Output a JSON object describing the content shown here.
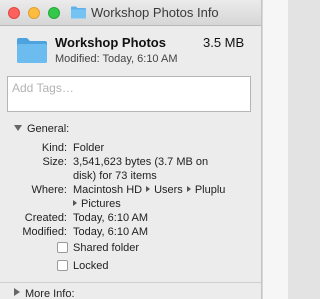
{
  "window": {
    "title": "Workshop Photos Info"
  },
  "header": {
    "name": "Workshop Photos",
    "size": "3.5 MB",
    "modified": "Modified: Today, 6:10 AM"
  },
  "tags": {
    "placeholder": "Add Tags…"
  },
  "general": {
    "heading": "General:",
    "kind_label": "Kind:",
    "kind_value": "Folder",
    "size_label": "Size:",
    "size_value_line1": "3,541,623 bytes (3.7 MB on",
    "size_value_line2": "disk) for 73 items",
    "where_label": "Where:",
    "where_path": [
      "Macintosh HD",
      "Users",
      "Pluplu",
      "Pictures"
    ],
    "created_label": "Created:",
    "created_value": "Today, 6:10 AM",
    "modified_label": "Modified:",
    "modified_value": "Today, 6:10 AM",
    "shared_folder_label": "Shared folder",
    "locked_label": "Locked"
  },
  "more_info": {
    "heading": "More Info:"
  },
  "icons": [
    "folder-icon",
    "disclosure-down-icon",
    "disclosure-right-icon",
    "path-arrow-icon"
  ],
  "colors": {
    "folder": "#5eb2ea",
    "close": "#fc615d",
    "minimize": "#fdbc40",
    "zoom": "#34c84a"
  }
}
